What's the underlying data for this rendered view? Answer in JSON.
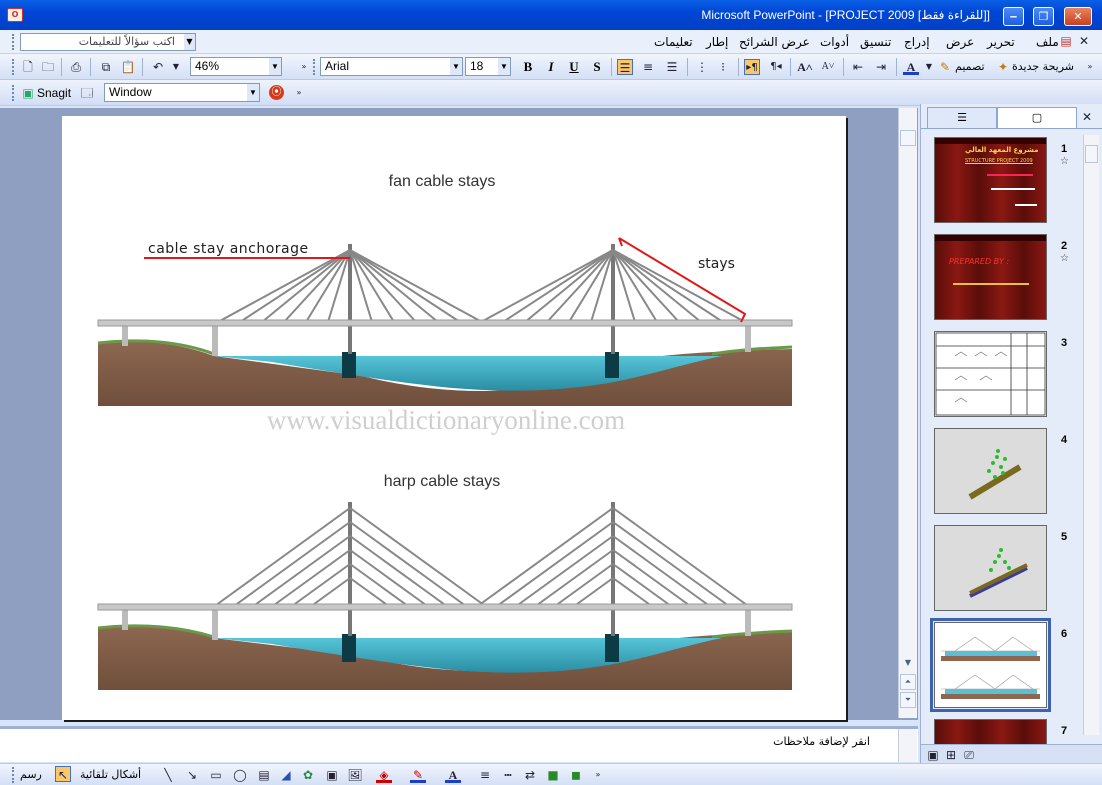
{
  "window": {
    "title": "Microsoft PowerPoint - [PROJECT 2009 [للقراءة فقط]]",
    "app_icon": "O"
  },
  "menu": {
    "help_placeholder": "اكتب سؤالاً للتعليمات",
    "items": [
      "ملف",
      "تحرير",
      "عرض",
      "إدراج",
      "تنسيق",
      "أدوات",
      "عرض الشرائح",
      "إطار",
      "تعليمات"
    ]
  },
  "standard": {
    "zoom": "46%",
    "font_name": "Arial",
    "font_size": "18",
    "new_slide": "شريحة جديدة",
    "design": "تصميم",
    "bold": "B",
    "italic": "I",
    "underline": "U",
    "shadow": "S"
  },
  "snagit": {
    "label": "Snagit",
    "capture_mode": "Window"
  },
  "slide": {
    "title_fan": "fan cable stays",
    "label_anchorage": "cable stay anchorage",
    "label_stays": "stays",
    "watermark": "www.visualdictionaryonline.com",
    "title_harp": "harp cable stays"
  },
  "notes_placeholder": "انقر لإضافة ملاحظات",
  "thumbnails": [
    {
      "num": "1",
      "star": "☆",
      "texts": [
        "مشروع المعهد العالي",
        "STRUCTURE PROJECT 2009"
      ]
    },
    {
      "num": "2",
      "star": "☆",
      "texts": [
        "PREPARED BY :"
      ]
    },
    {
      "num": "3"
    },
    {
      "num": "4"
    },
    {
      "num": "5"
    },
    {
      "num": "6"
    },
    {
      "num": "7"
    }
  ],
  "draw": {
    "draw_label": "رسم",
    "autoshapes": "أشكال تلقائية"
  }
}
